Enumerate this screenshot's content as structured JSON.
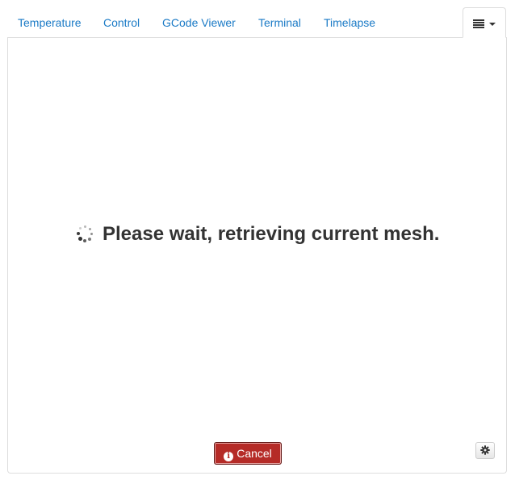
{
  "tabs": [
    {
      "label": "Temperature"
    },
    {
      "label": "Control"
    },
    {
      "label": "GCode Viewer"
    },
    {
      "label": "Terminal"
    },
    {
      "label": "Timelapse"
    }
  ],
  "tab_menu": {
    "icon": "list-icon",
    "caret": "caret-down-icon"
  },
  "panel": {
    "loading_icon": "spinner-icon",
    "loading_text": "Please wait, retrieving current mesh."
  },
  "buttons": {
    "cancel_icon": "info-circle-icon",
    "cancel_label": "Cancel",
    "settings_icon": "gear-icon"
  },
  "colors": {
    "link": "#1a7ac6",
    "text": "#333333",
    "danger": "#b52b27",
    "border": "#dddddd"
  }
}
